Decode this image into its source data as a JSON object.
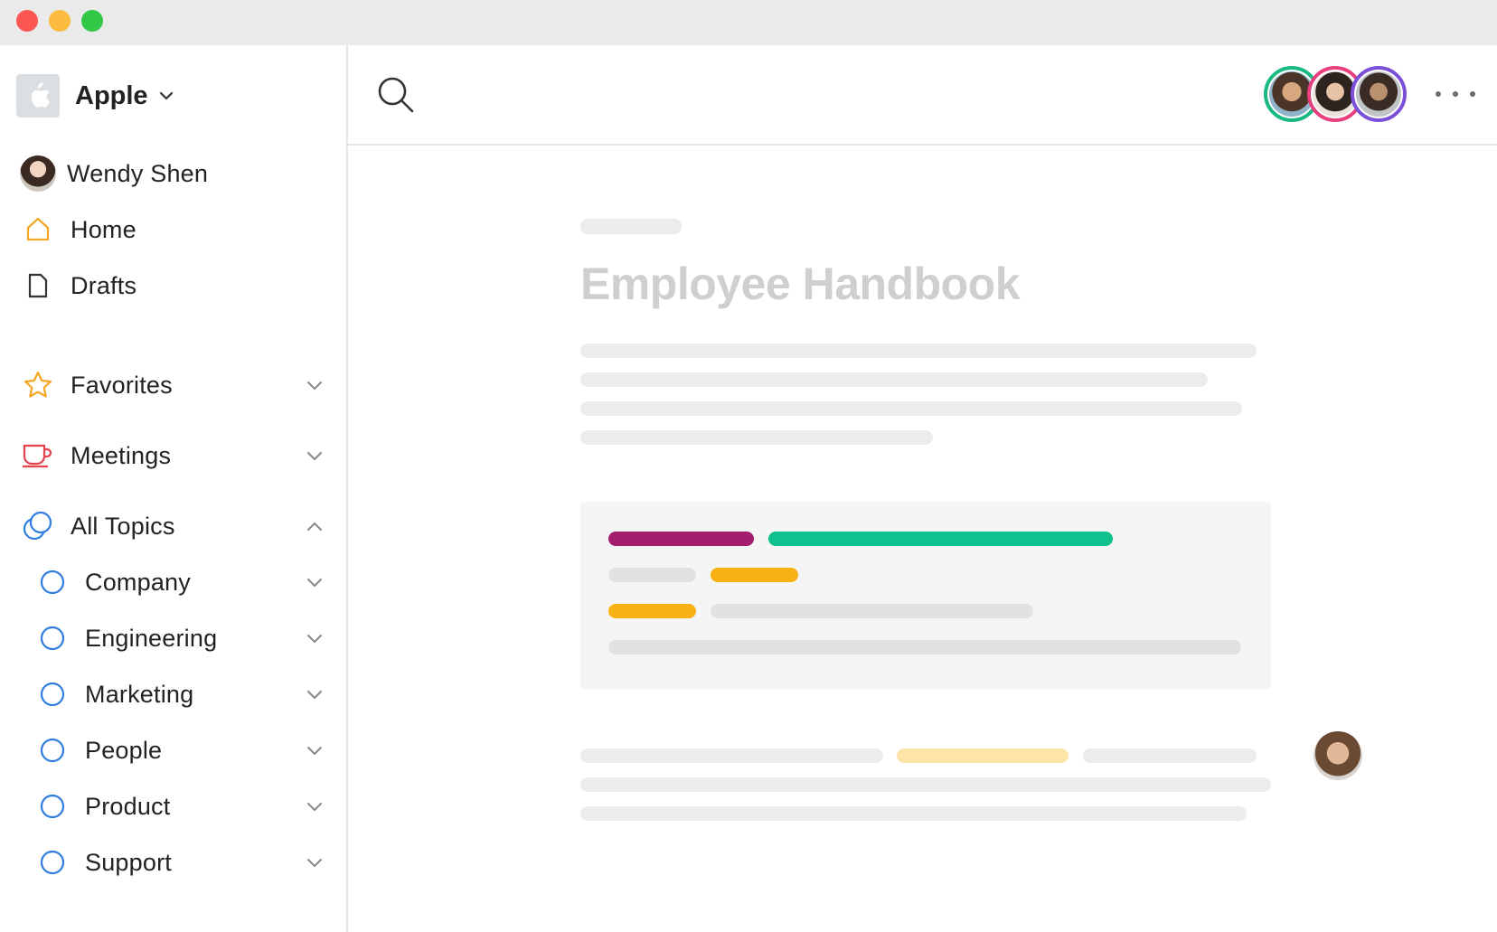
{
  "window": {
    "controls": [
      "close",
      "minimize",
      "zoom"
    ],
    "colors": {
      "close": "#fc5753",
      "minimize": "#fdbc40",
      "zoom": "#33c748"
    }
  },
  "sidebar": {
    "workspace": {
      "name": "Apple",
      "logo_icon": "apple-logo-icon"
    },
    "user": {
      "name": "Wendy Shen"
    },
    "primary": [
      {
        "label": "Home",
        "icon": "home-icon",
        "color": "#f5a623"
      },
      {
        "label": "Drafts",
        "icon": "drafts-icon",
        "color": "#333333"
      }
    ],
    "sections": [
      {
        "label": "Favorites",
        "icon": "star-icon",
        "color": "#f5a623",
        "expanded": false
      },
      {
        "label": "Meetings",
        "icon": "coffee-cup-icon",
        "color": "#e5424d",
        "expanded": false
      },
      {
        "label": "All Topics",
        "icon": "topics-icon",
        "color": "#2f7de1",
        "expanded": true
      }
    ],
    "topics": [
      {
        "label": "Company"
      },
      {
        "label": "Engineering"
      },
      {
        "label": "Marketing"
      },
      {
        "label": "People"
      },
      {
        "label": "Product"
      },
      {
        "label": "Support"
      }
    ],
    "topic_circle_color": "#2f7de1"
  },
  "header": {
    "search_icon": "search-icon",
    "collaborators": [
      {
        "ring_color": "#18b982"
      },
      {
        "ring_color": "#e8407e"
      },
      {
        "ring_color": "#7b4fd6"
      }
    ],
    "more_icon": "more-horizontal-icon"
  },
  "document": {
    "title": "Employee Handbook",
    "highlight_colors": {
      "magenta": "#a51e6e",
      "green": "#10c08d",
      "amber": "#f8b214",
      "light_amber": "#fde4a9",
      "placeholder": "#e2e2e2"
    }
  }
}
